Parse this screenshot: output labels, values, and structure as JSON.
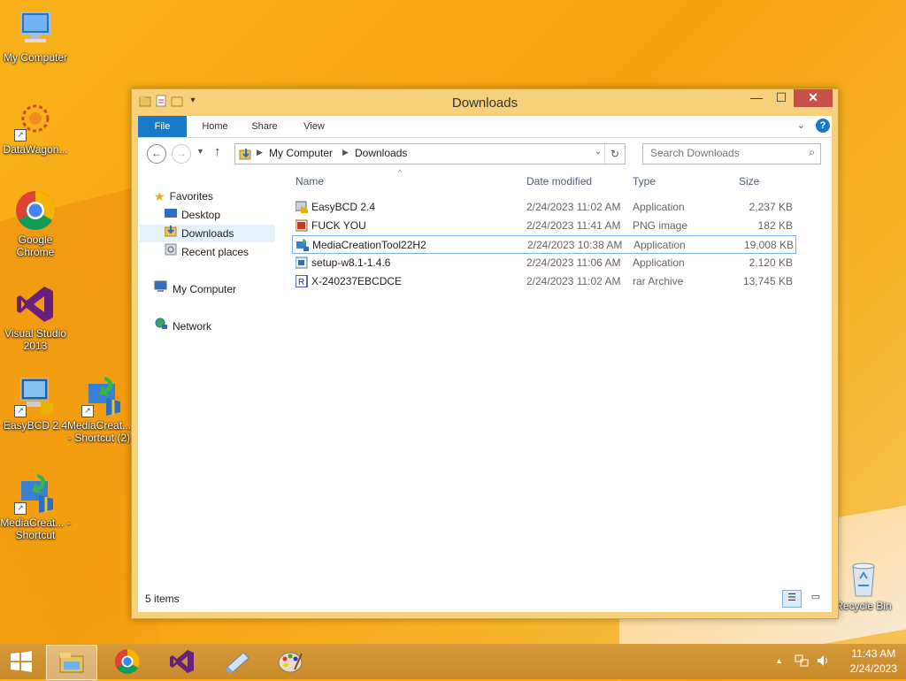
{
  "desktop": {
    "icons": [
      {
        "label": "My Computer"
      },
      {
        "label": "DataWagon..."
      },
      {
        "label": "Google Chrome"
      },
      {
        "label": "Visual Studio 2013"
      },
      {
        "label": "EasyBCD 2.4"
      },
      {
        "label": "MediaCreat... - Shortcut (2)"
      },
      {
        "label": "MediaCreat... - Shortcut"
      },
      {
        "label": "Recycle Bin"
      }
    ]
  },
  "window": {
    "title": "Downloads",
    "ribbon_tabs": [
      "File",
      "Home",
      "Share",
      "View"
    ],
    "breadcrumb": [
      "My Computer",
      "Downloads"
    ],
    "search_placeholder": "Search Downloads",
    "nav": {
      "favorites": "Favorites",
      "desktop": "Desktop",
      "downloads": "Downloads",
      "recent": "Recent places",
      "computer": "My Computer",
      "network": "Network"
    },
    "columns": {
      "name": "Name",
      "date": "Date modified",
      "type": "Type",
      "size": "Size"
    },
    "files": [
      {
        "name": "EasyBCD 2.4",
        "date": "2/24/2023 11:02 AM",
        "type": "Application",
        "size": "2,237 KB"
      },
      {
        "name": "FUCK YOU",
        "date": "2/24/2023 11:41 AM",
        "type": "PNG image",
        "size": "182 KB"
      },
      {
        "name": "MediaCreationTool22H2",
        "date": "2/24/2023 10:38 AM",
        "type": "Application",
        "size": "19,008 KB"
      },
      {
        "name": "setup-w8.1-1.4.6",
        "date": "2/24/2023 11:06 AM",
        "type": "Application",
        "size": "2,120 KB"
      },
      {
        "name": "X-240237EBCDCE",
        "date": "2/24/2023 11:02 AM",
        "type": "rar Archive",
        "size": "13,745 KB"
      }
    ],
    "status": "5 items"
  },
  "taskbar": {
    "time": "11:43 AM",
    "date": "2/24/2023"
  },
  "colors": {
    "accent": "#1979ca",
    "desktop": "#f5a20f",
    "close": "#c7504b"
  }
}
